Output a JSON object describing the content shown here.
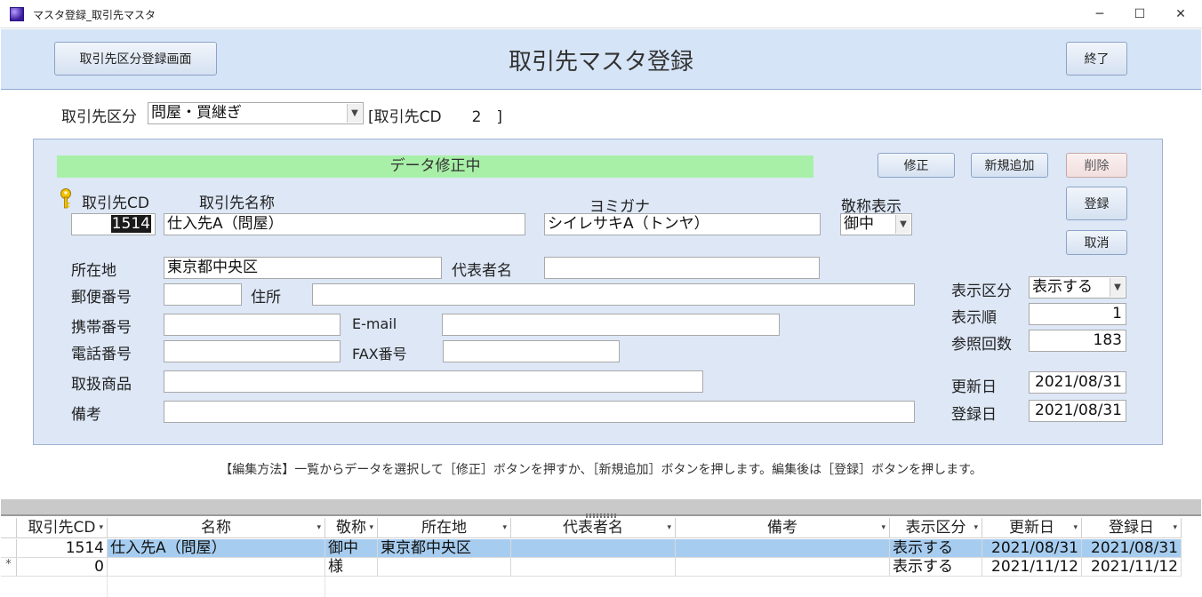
{
  "window": {
    "title": "マスタ登録_取引先マスタ",
    "minimize": "─",
    "maximize": "☐",
    "close": "✕"
  },
  "header": {
    "category_screen_button": "取引先区分登録画面",
    "title": "取引先マスタ登録",
    "exit_button": "終了"
  },
  "category": {
    "label": "取引先区分",
    "value": "問屋・買継ぎ",
    "code_display": "[取引先CD　　2　]"
  },
  "detail": {
    "status": "データ修正中",
    "buttons": {
      "edit": "修正",
      "new": "新規追加",
      "delete": "削除",
      "register": "登録",
      "cancel": "取消"
    },
    "labels": {
      "code": "取引先CD",
      "name": "取引先名称",
      "kana": "ヨミガナ",
      "honorific": "敬称表示",
      "location": "所在地",
      "representative": "代表者名",
      "postal": "郵便番号",
      "address": "住所",
      "mobile": "携帯番号",
      "email": "E-mail",
      "phone": "電話番号",
      "fax": "FAX番号",
      "products": "取扱商品",
      "notes": "備考",
      "display_flag": "表示区分",
      "display_order": "表示順",
      "ref_count": "参照回数",
      "updated": "更新日",
      "registered": "登録日"
    },
    "values": {
      "code": "1514",
      "name": "仕入先A（問屋）",
      "kana": "シイレサキA（トンヤ）",
      "honorific": "御中",
      "location": "東京都中央区",
      "representative": "",
      "postal": "",
      "address": "",
      "mobile": "",
      "email": "",
      "phone": "",
      "fax": "",
      "products": "",
      "notes": "",
      "display_flag": "表示する",
      "display_order": "1",
      "ref_count": "183",
      "updated": "2021/08/31",
      "registered": "2021/08/31"
    }
  },
  "help": "【編集方法】一覧からデータを選択して［修正］ボタンを押すか、［新規追加］ボタンを押します。編集後は［登録］ボタンを押します。",
  "grid": {
    "columns": [
      "取引先CD",
      "名称",
      "敬称",
      "所在地",
      "代表者名",
      "備考",
      "表示区分",
      "更新日",
      "登録日"
    ],
    "rows": [
      {
        "marker": "",
        "code": "1514",
        "name": "仕入先A（問屋）",
        "honorific": "御中",
        "location": "東京都中央区",
        "rep": "",
        "notes": "",
        "flag": "表示する",
        "updated": "2021/08/31",
        "registered": "2021/08/31"
      },
      {
        "marker": "*",
        "code": "0",
        "name": "",
        "honorific": "様",
        "location": "",
        "rep": "",
        "notes": "",
        "flag": "表示する",
        "updated": "2021/11/12",
        "registered": "2021/11/12"
      }
    ]
  },
  "colors": {
    "header_bg": "#d6e4f7",
    "panel_bg": "#dde7f6",
    "status_bg": "#a8f0a8",
    "selected_row": "#a6cdf0"
  }
}
